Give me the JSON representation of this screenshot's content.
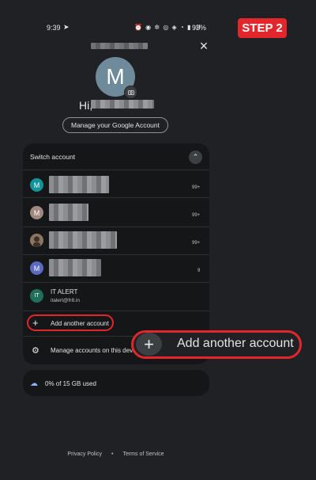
{
  "status_bar": {
    "time": "9:39",
    "send_icon": "➤",
    "icons": "⏰ ◉ ✲ ◎ ◈ ◔ ▮ ıll",
    "battery": "93%"
  },
  "badge": {
    "label": "STEP 2",
    "color": "#e3262b"
  },
  "header": {
    "close": "×",
    "avatar_letter": "M",
    "greeting": "Hi,",
    "manage_button": "Manage your Google Account"
  },
  "switch": {
    "title": "Switch account",
    "chevron": "⌃",
    "accounts": [
      {
        "letter": "M",
        "color": "#12939a",
        "count": "99+"
      },
      {
        "letter": "M",
        "color": "#a1887f",
        "count": "99+"
      },
      {
        "letter": "",
        "color": "#7a6a5a",
        "count": "99+"
      },
      {
        "letter": "M",
        "color": "#5c6bc0",
        "count": "9"
      }
    ],
    "it_account": {
      "letter": "IT",
      "color": "#1f6f5a",
      "name": "IT ALERT",
      "email": "italert@fr8.in"
    }
  },
  "actions": {
    "add_plus": "+",
    "add_label": "Add another account",
    "manage_icon": "⚙",
    "manage_label": "Manage accounts on this device"
  },
  "callout": {
    "plus": "+",
    "label": "Add another account"
  },
  "storage": {
    "icon": "☁",
    "text": "0% of 15 GB used"
  },
  "footer": {
    "privacy": "Privacy Policy",
    "dot": "•",
    "terms": "Terms of Service"
  }
}
